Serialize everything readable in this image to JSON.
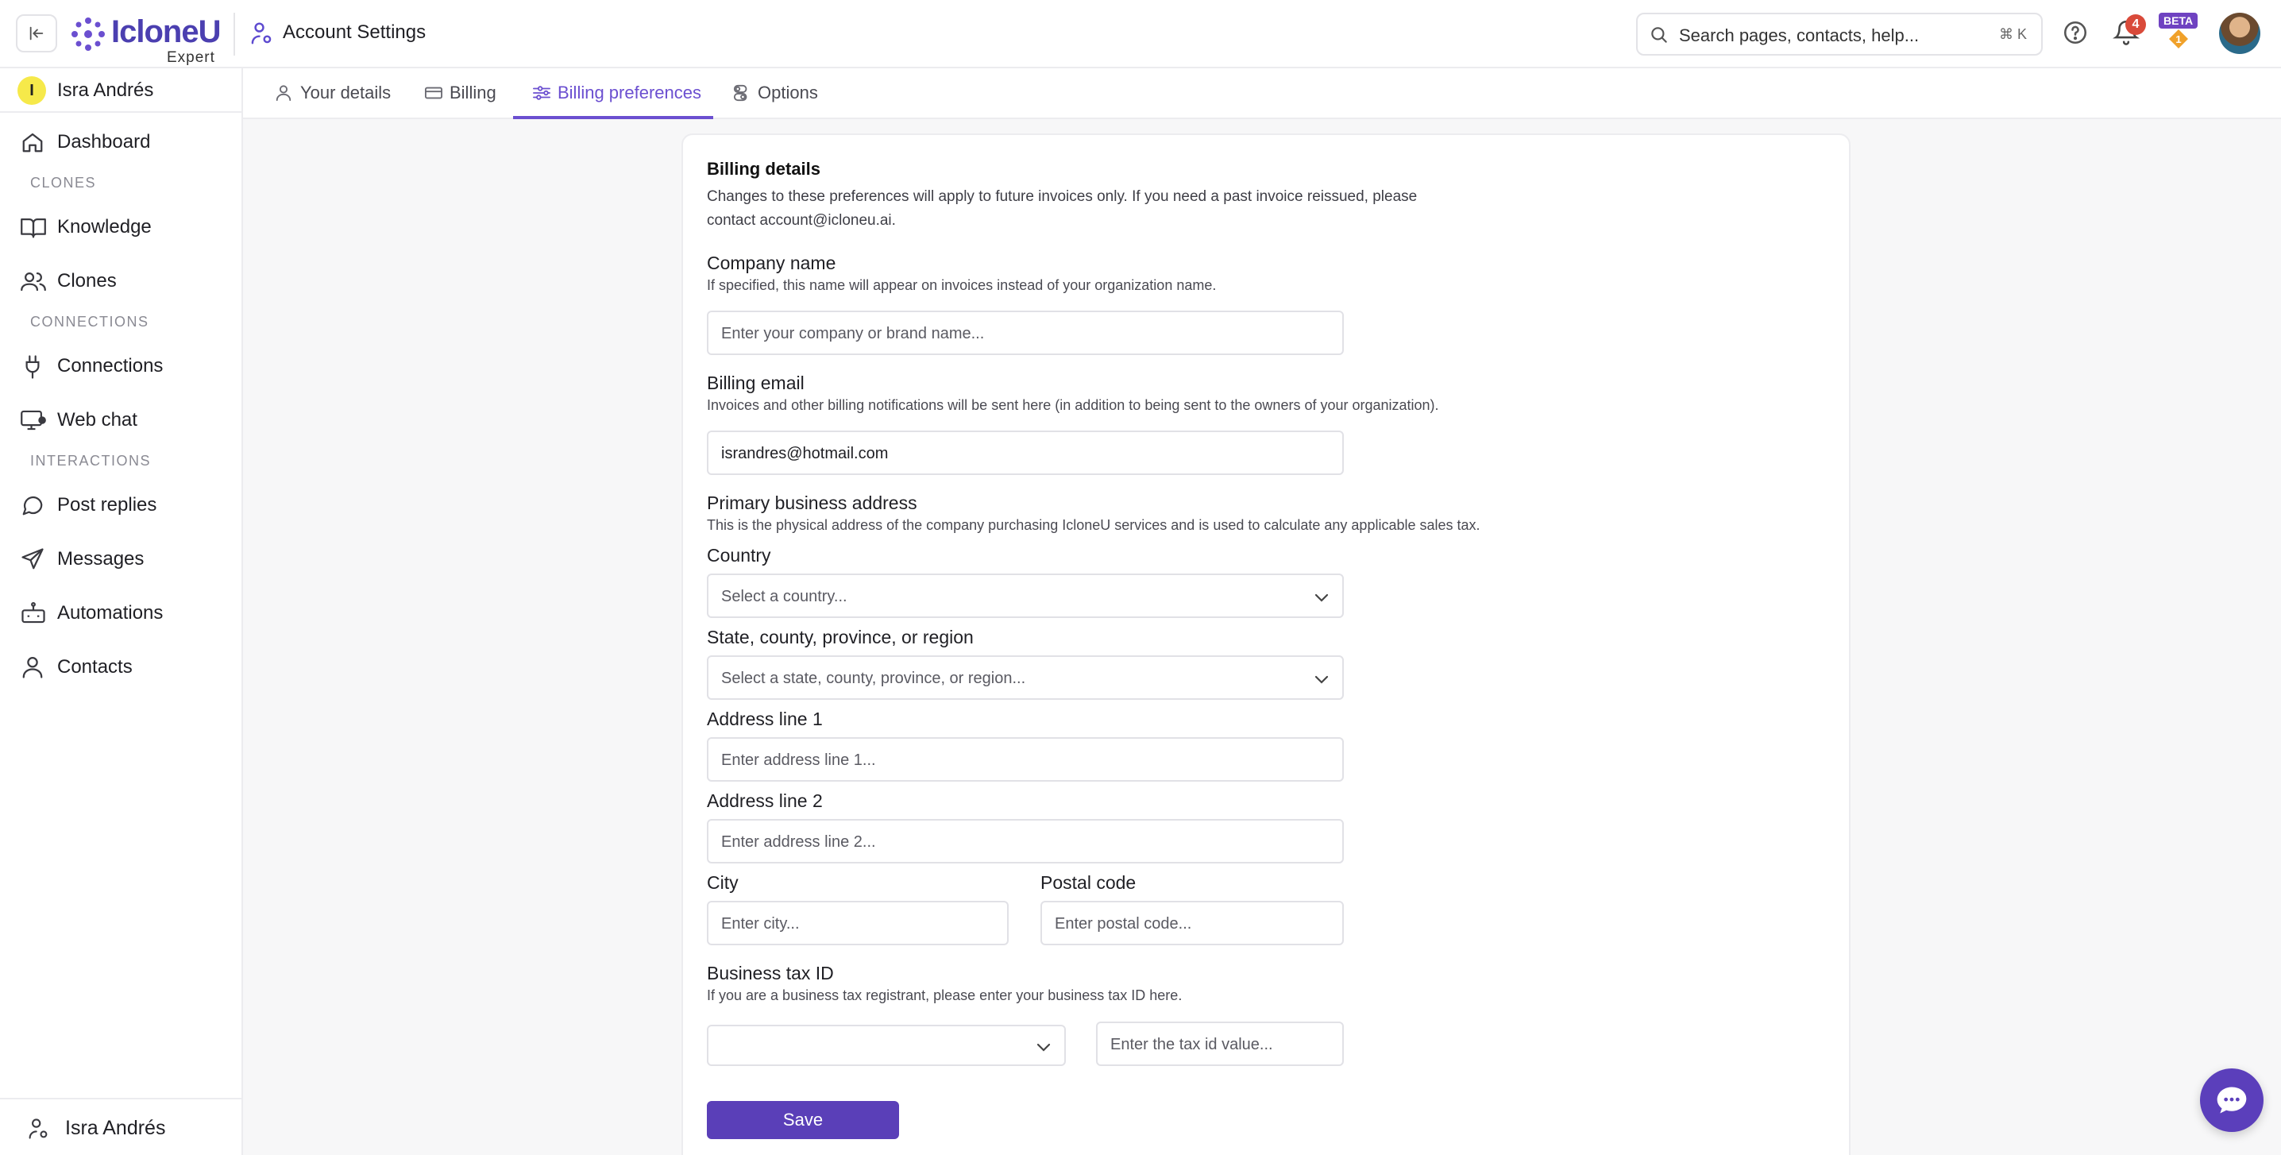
{
  "topbar": {
    "brand": "IcloneU",
    "brand_sub": "Expert",
    "page_title": "Account Settings",
    "search_placeholder": "Search pages, contacts, help...",
    "search_shortcut": "⌘ K",
    "notifications_count": "4",
    "beta_label": "BETA",
    "beta_gem_value": "1"
  },
  "sidebar": {
    "org_initial": "I",
    "org_name": "Isra Andrés",
    "items": [
      {
        "label": "Dashboard",
        "icon": "home-icon"
      },
      {
        "label": "Knowledge",
        "icon": "book-icon"
      },
      {
        "label": "Clones",
        "icon": "users-icon"
      },
      {
        "label": "Connections",
        "icon": "plug-icon"
      },
      {
        "label": "Web chat",
        "icon": "monitor-icon"
      },
      {
        "label": "Post replies",
        "icon": "chat-bubble-icon"
      },
      {
        "label": "Messages",
        "icon": "send-icon"
      },
      {
        "label": "Automations",
        "icon": "robot-icon"
      },
      {
        "label": "Contacts",
        "icon": "user-icon"
      }
    ],
    "sections": {
      "clones": "CLONES",
      "connections": "CONNECTIONS",
      "interactions": "INTERACTIONS"
    },
    "footer_user": "Isra Andrés"
  },
  "tabs": [
    {
      "label": "Your details",
      "icon": "user-icon"
    },
    {
      "label": "Billing",
      "icon": "credit-card-icon"
    },
    {
      "label": "Billing preferences",
      "icon": "sliders-icon",
      "active": true
    },
    {
      "label": "Options",
      "icon": "toggle-icon"
    }
  ],
  "form": {
    "section_title": "Billing details",
    "section_desc_1": "Changes to these preferences will apply to future invoices only. If you need a past invoice reissued, please",
    "section_desc_2": "contact account@icloneu.ai.",
    "company": {
      "title": "Company name",
      "help": "If specified, this name will appear on invoices instead of your organization name.",
      "placeholder": "Enter your company or brand name..."
    },
    "email": {
      "title": "Billing email",
      "help": "Invoices and other billing notifications will be sent here (in addition to being sent to the owners of your organization).",
      "value": "israndres@hotmail.com"
    },
    "address": {
      "title": "Primary business address",
      "help": "This is the physical address of the company purchasing IcloneU services and is used to calculate any applicable sales tax.",
      "country_label": "Country",
      "country_placeholder": "Select a country...",
      "state_label": "State, county, province, or region",
      "state_placeholder": "Select a state, county, province, or region...",
      "line1_label": "Address line 1",
      "line1_placeholder": "Enter address line 1...",
      "line2_label": "Address line 2",
      "line2_placeholder": "Enter address line 2...",
      "city_label": "City",
      "city_placeholder": "Enter city...",
      "postal_label": "Postal code",
      "postal_placeholder": "Enter postal code..."
    },
    "tax": {
      "title": "Business tax ID",
      "help": "If you are a business tax registrant, please enter your business tax ID here.",
      "type_value": "",
      "value_placeholder": "Enter the tax id value..."
    },
    "save_label": "Save"
  },
  "colors": {
    "accent": "#6b4fd0",
    "save_button": "#5a3fb8",
    "badge_red": "#d94a3a",
    "beta_purple": "#6f42c1"
  }
}
